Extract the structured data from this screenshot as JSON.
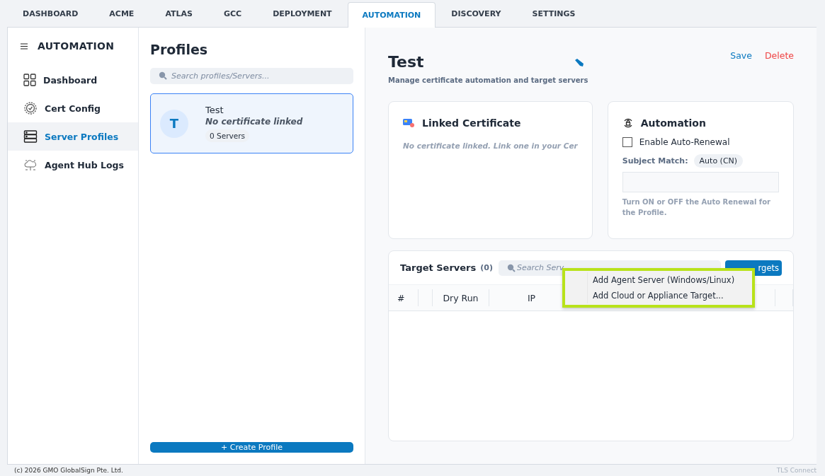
{
  "top_tabs": [
    {
      "label": "DASHBOARD",
      "selected": false
    },
    {
      "label": "ACME",
      "selected": false
    },
    {
      "label": "ATLAS",
      "selected": false
    },
    {
      "label": "GCC",
      "selected": false
    },
    {
      "label": "DEPLOYMENT",
      "selected": false
    },
    {
      "label": "AUTOMATION",
      "selected": true
    },
    {
      "label": "DISCOVERY",
      "selected": false
    },
    {
      "label": "SETTINGS",
      "selected": false
    }
  ],
  "sidebar": {
    "title": "AUTOMATION",
    "items": [
      {
        "label": "Dashboard",
        "selected": false
      },
      {
        "label": "Cert Config",
        "selected": false
      },
      {
        "label": "Server Profiles",
        "selected": true
      },
      {
        "label": "Agent Hub Logs",
        "selected": false
      }
    ]
  },
  "profiles": {
    "title": "Profiles",
    "search": {
      "placeholder": "Search profiles/Servers..."
    },
    "items": [
      {
        "initial": "T",
        "name": "Test",
        "subtitle": "No certificate linked",
        "servers": "0 Servers",
        "selected": true
      }
    ],
    "create_button": "+ Create Profile"
  },
  "detail": {
    "title": "Test",
    "subtitle": "Manage certificate automation and target servers",
    "save": "Save",
    "delete": "Delete",
    "linked_certificate": {
      "title": "Linked Certificate",
      "message": "No certificate linked. Link one in your Cer"
    },
    "automation": {
      "title": "Automation",
      "checkbox": {
        "label": "Enable Auto-Renewal",
        "checked": false
      },
      "subject_label": "Subject Match:",
      "subject_value": "Auto (CN)",
      "hint": "Turn ON or OFF the Auto Renewal for the Profile."
    },
    "target_servers": {
      "title": "Target Servers",
      "count": "(0)",
      "search": {
        "placeholder": "Search Serv"
      },
      "add_button": "rgets",
      "columns": [
        "#",
        "",
        "Dry Run",
        "IP",
        "",
        "",
        "",
        "",
        ""
      ]
    }
  },
  "context_menu": {
    "items": [
      "Add Agent Server (Windows/Linux)",
      "Add Cloud or Appliance Target..."
    ]
  },
  "footer": {
    "copyright": "(c) 2026 GMO GlobalSign Pte. Ltd.",
    "product": "TLS Connect"
  }
}
